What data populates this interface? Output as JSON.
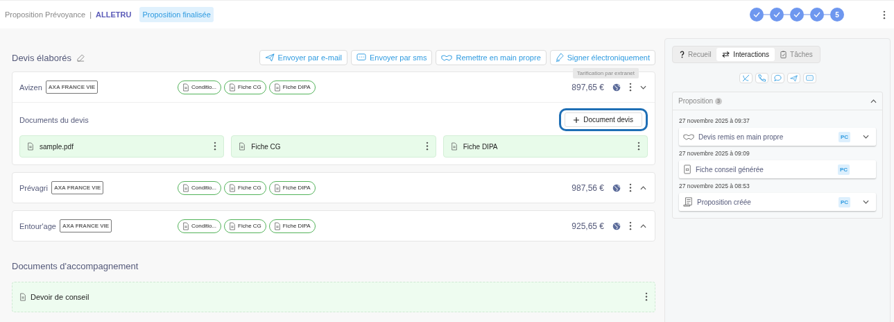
{
  "header": {
    "breadcrumb": "Proposition Prévoyance",
    "separator": "|",
    "client": "ALLETRU",
    "status": "Proposition finalisée",
    "steps": [
      {
        "done": true
      },
      {
        "done": true
      },
      {
        "done": true
      },
      {
        "done": true
      },
      {
        "done": false,
        "label": "5"
      }
    ]
  },
  "quotes_section": {
    "title": "Devis élaborés",
    "actions": [
      {
        "kind": "email",
        "label": "Envoyer par e-mail"
      },
      {
        "kind": "sms",
        "label": "Envoyer par sms"
      },
      {
        "kind": "hand",
        "label": "Remettre en main propre"
      },
      {
        "kind": "sign",
        "label": "Signer électroniquement"
      }
    ],
    "tooltip": "Tarification par extranet",
    "quotes": [
      {
        "name": "Avizen",
        "insurer": "AXA FRANCE VIE",
        "chips": [
          "Conditio...",
          "Fiche CG",
          "Fiche DIPA"
        ],
        "price": "897,65 €",
        "expanded": true,
        "documents_title": "Documents du devis",
        "add_button": {
          "label": "Document devis",
          "highlighted": true
        },
        "documents": [
          "sample.pdf",
          "Fiche CG",
          "Fiche DIPA"
        ]
      },
      {
        "name": "Prévagri",
        "insurer": "AXA FRANCE VIE",
        "chips": [
          "Conditio...",
          "Fiche CG",
          "Fiche DIPA"
        ],
        "price": "987,56 €",
        "expanded": false
      },
      {
        "name": "Entour'age",
        "insurer": "AXA FRANCE VIE",
        "chips": [
          "Conditio...",
          "Fiche CG",
          "Fiche DIPA"
        ],
        "price": "925,65 €",
        "expanded": false
      }
    ]
  },
  "accompanying": {
    "title": "Documents d'accompagnement",
    "documents": [
      "Devoir de conseil"
    ]
  },
  "side_panel": {
    "tabs": [
      {
        "kind": "help",
        "label": "Recueil",
        "selected": false
      },
      {
        "kind": "swap",
        "label": "Interactions",
        "selected": true
      },
      {
        "kind": "task",
        "label": "Tâches",
        "selected": false
      }
    ],
    "group": {
      "title": "Proposition",
      "count": "3",
      "expanded": true,
      "events": [
        {
          "date": "27 novembre 2025 à 09:37",
          "kind": "hand",
          "title": "Devis remis en main propre",
          "initials": "PC",
          "expandable": true
        },
        {
          "date": "27 novembre 2025 à 09:09",
          "kind": "doc",
          "title": "Fiche conseil générée",
          "initials": "PC",
          "expandable": false
        },
        {
          "date": "27 novembre 2025 à 08:53",
          "kind": "scroll",
          "title": "Proposition créée",
          "initials": "PC",
          "expandable": true
        }
      ]
    }
  }
}
